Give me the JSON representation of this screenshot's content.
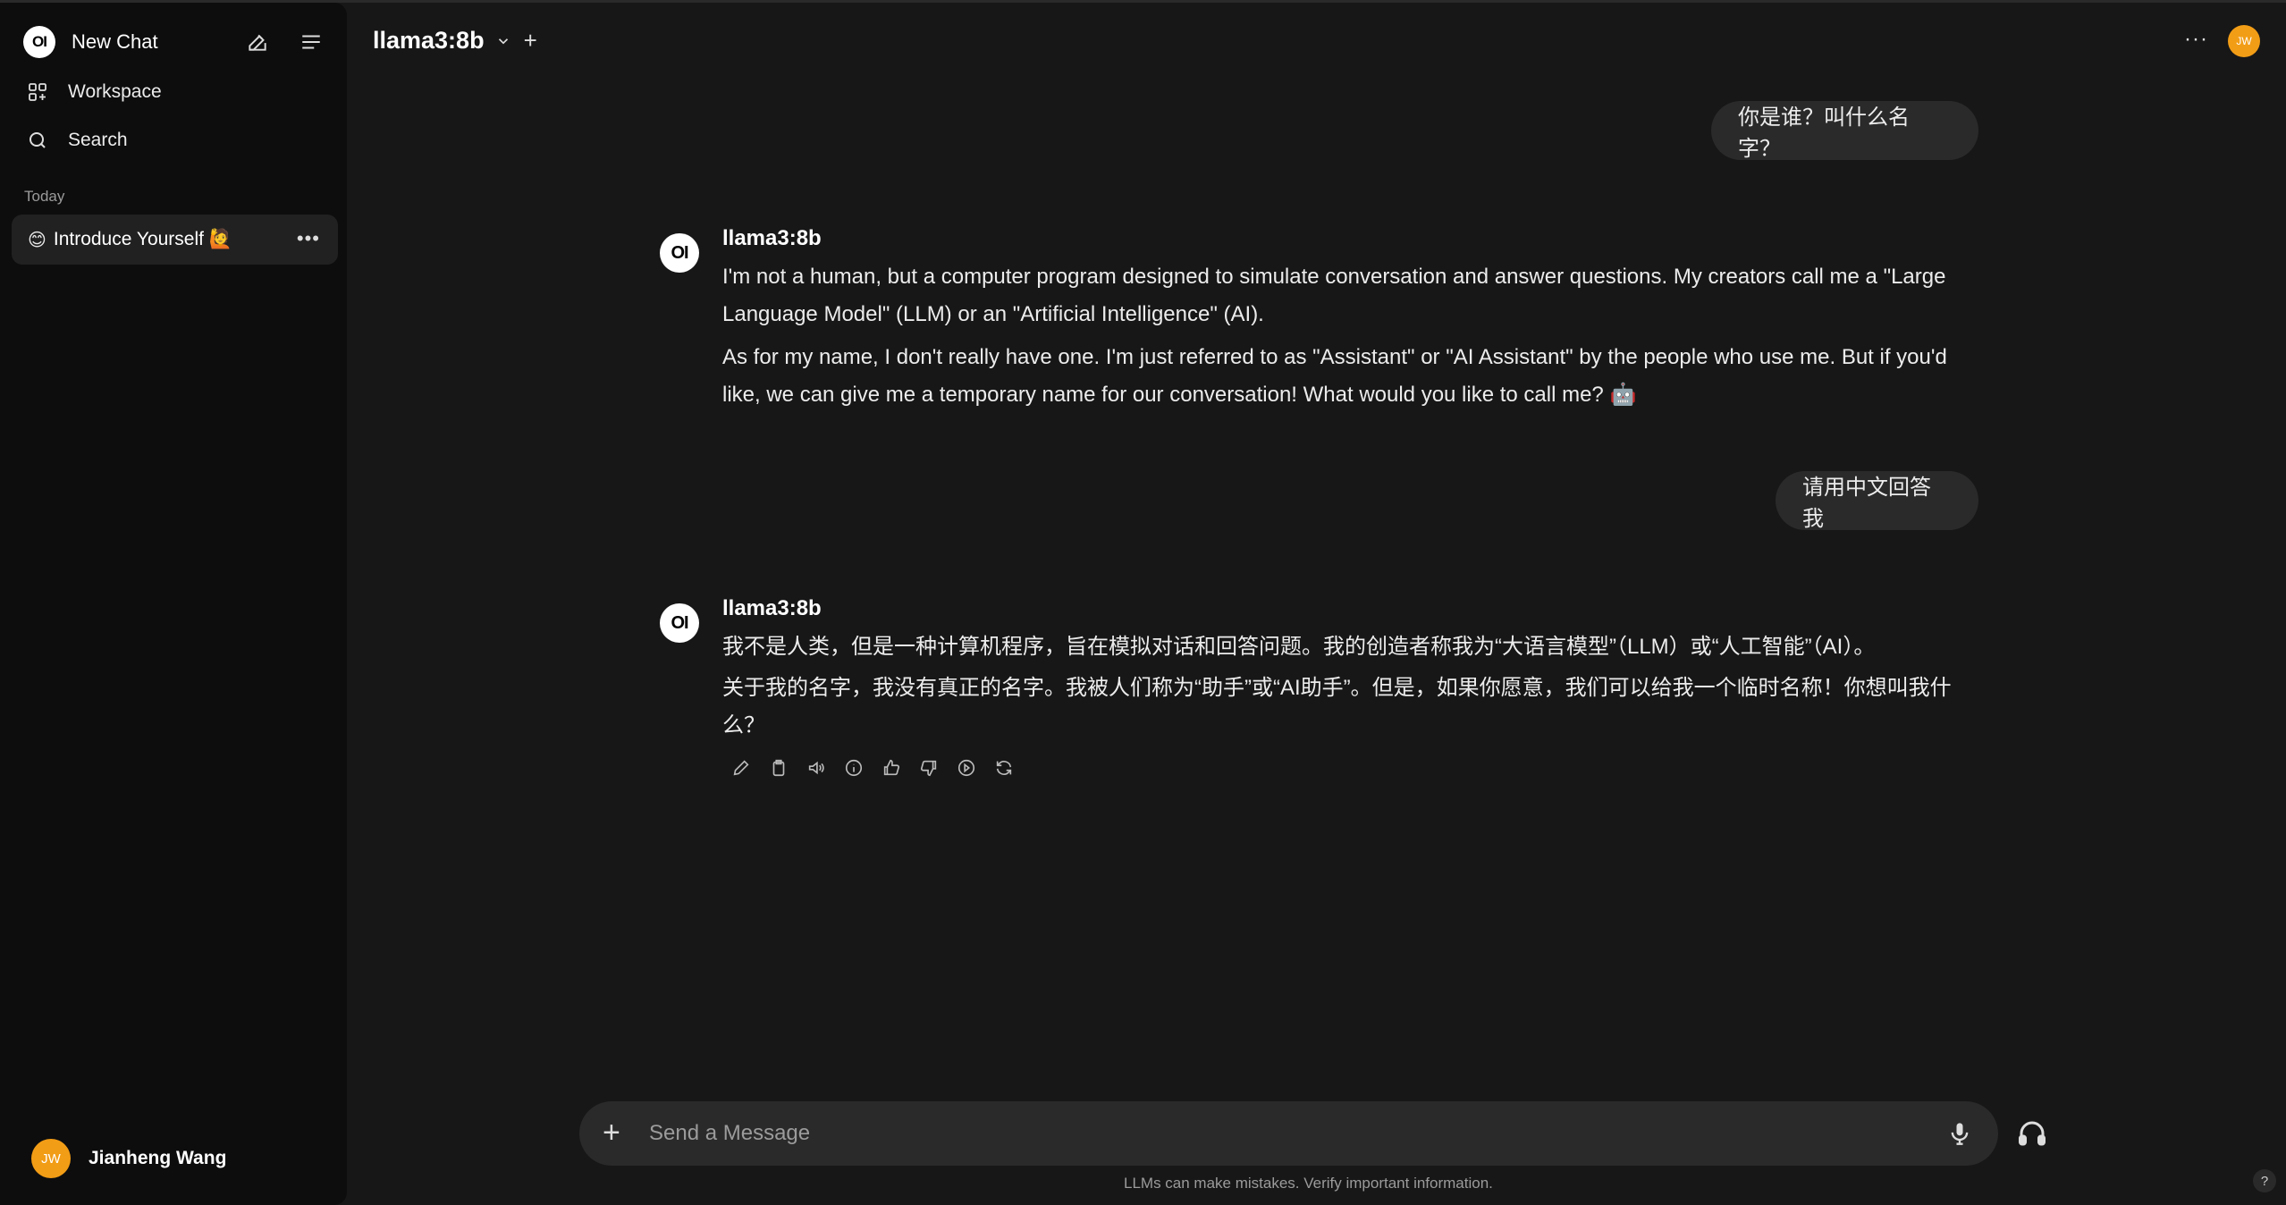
{
  "sidebar": {
    "logo_text": "OI",
    "new_chat_label": "New Chat",
    "workspace_label": "Workspace",
    "search_label": "Search",
    "section_today": "Today",
    "chats": [
      {
        "emoji": "😊",
        "label": "Introduce Yourself 🙋"
      }
    ],
    "user": {
      "initials": "JW",
      "name": "Jianheng Wang"
    }
  },
  "header": {
    "model_name": "llama3:8b",
    "more_label": "···",
    "avatar_initials": "JW"
  },
  "messages": [
    {
      "role": "user",
      "text": "你是谁？叫什么名字？"
    },
    {
      "role": "assistant",
      "model": "llama3:8b",
      "paragraphs": [
        "I'm not a human, but a computer program designed to simulate conversation and answer questions. My creators call me a \"Large Language Model\" (LLM) or an \"Artificial Intelligence\" (AI).",
        "As for my name, I don't really have one. I'm just referred to as \"Assistant\" or \"AI Assistant\" by the people who use me. But if you'd like, we can give me a temporary name for our conversation! What would you like to call me? 🤖"
      ]
    },
    {
      "role": "user",
      "text": "请用中文回答我"
    },
    {
      "role": "assistant",
      "model": "llama3:8b",
      "paragraphs": [
        "我不是人类，但是一种计算机程序，旨在模拟对话和回答问题。我的创造者称我为“大语言模型”（LLM）或“人工智能”（AI）。",
        "关于我的名字，我没有真正的名字。我被人们称为“助手”或“AI助手”。但是，如果你愿意，我们可以给我一个临时名称！你想叫我什么？"
      ]
    }
  ],
  "message_actions": [
    "edit-icon",
    "copy-icon",
    "read-aloud-icon",
    "info-icon",
    "thumbs-up-icon",
    "thumbs-down-icon",
    "continue-icon",
    "regenerate-icon"
  ],
  "composer": {
    "placeholder": "Send a Message",
    "disclaimer": "LLMs can make mistakes. Verify important information."
  },
  "help_label": "?",
  "colors": {
    "background": "#171717",
    "sidebar": "#0d0d0d",
    "bubble": "#2a2a2a",
    "avatar": "#f29d16"
  }
}
